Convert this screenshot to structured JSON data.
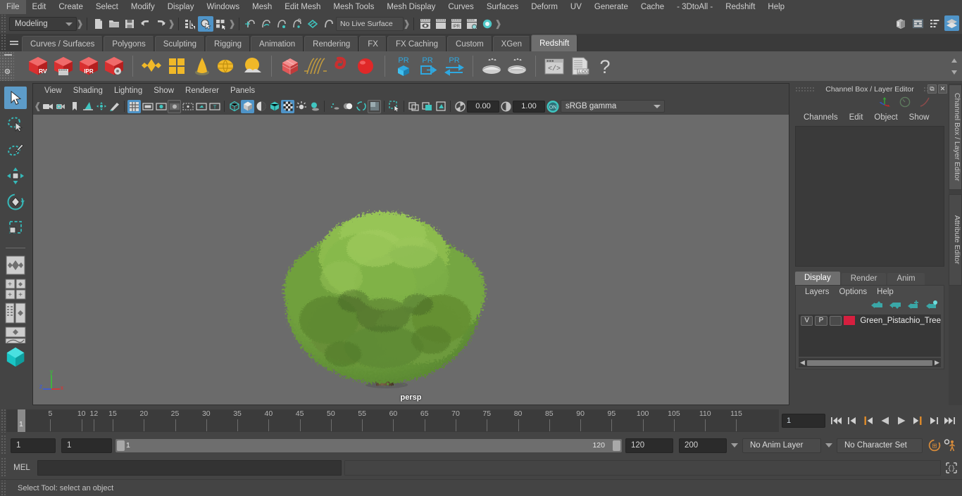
{
  "menubar": {
    "items": [
      "File",
      "Edit",
      "Create",
      "Select",
      "Modify",
      "Display",
      "Windows",
      "Mesh",
      "Edit Mesh",
      "Mesh Tools",
      "Mesh Display",
      "Curves",
      "Surfaces",
      "Deform",
      "UV",
      "Generate",
      "Cache",
      "- 3DtoAll -",
      "Redshift",
      "Help"
    ]
  },
  "statusline": {
    "mode": "Modeling",
    "live_surface": "No Live Surface",
    "icons": [
      "new-scene-icon",
      "open-scene-icon",
      "save-scene-icon",
      "undo-icon",
      "redo-icon",
      "select-by-hierarchy-icon",
      "select-by-object-icon",
      "select-by-component-icon",
      "snap-to-grid-icon",
      "snap-to-curve-icon",
      "snap-to-point-icon",
      "snap-to-projected-center-icon",
      "snap-to-view-plane-icon",
      "make-live-icon",
      "render-view-icon",
      "render-sequence-icon",
      "ipr-render-icon",
      "render-settings-icon",
      "render-globals-icon",
      "light-toggle-icon"
    ],
    "right_icons": [
      "show-hide-modeling-toolkit-icon",
      "show-hide-attribute-editor-icon",
      "show-hide-tool-settings-icon",
      "show-hide-channel-box-icon"
    ]
  },
  "shelf": {
    "tabs": [
      "Curves / Surfaces",
      "Polygons",
      "Sculpting",
      "Rigging",
      "Animation",
      "Rendering",
      "FX",
      "FX Caching",
      "Custom",
      "XGen",
      "Redshift"
    ],
    "selected_tab": "Redshift",
    "icons": [
      {
        "name": "redshift-render-view-icon",
        "label": "RV"
      },
      {
        "name": "redshift-render-sequence-icon",
        "label": ""
      },
      {
        "name": "redshift-ipr-icon",
        "label": "IPR"
      },
      {
        "name": "redshift-render-settings-icon",
        "label": ""
      },
      {
        "name": "redshift-material-icon",
        "label": ""
      },
      {
        "name": "redshift-material-blender-icon",
        "label": ""
      },
      {
        "name": "redshift-light-cone-icon",
        "label": ""
      },
      {
        "name": "redshift-dome-light-icon",
        "label": ""
      },
      {
        "name": "redshift-environment-icon",
        "label": ""
      },
      {
        "name": "redshift-proxy-cube-icon",
        "label": ""
      },
      {
        "name": "redshift-hair-icon",
        "label": ""
      },
      {
        "name": "redshift-volume-icon",
        "label": ""
      },
      {
        "name": "redshift-sphere-icon",
        "label": ""
      },
      {
        "name": "redshift-pr-cube-icon",
        "label": "PR"
      },
      {
        "name": "redshift-pr-export-icon",
        "label": "PR"
      },
      {
        "name": "redshift-pr-swap-icon",
        "label": "PR"
      },
      {
        "name": "redshift-bake-icon",
        "label": ""
      },
      {
        "name": "redshift-bake-all-icon",
        "label": ""
      },
      {
        "name": "redshift-script-editor-icon",
        "label": ""
      },
      {
        "name": "redshift-log-icon",
        "label": ".LOG"
      },
      {
        "name": "redshift-help-icon",
        "label": "?"
      }
    ]
  },
  "toolbox": {
    "tools": [
      "select-tool",
      "lasso-select-tool",
      "paint-select-tool",
      "move-tool",
      "rotate-tool",
      "scale-tool"
    ],
    "selected_tool": "select-tool",
    "layouts": [
      "single-perspective-layout",
      "four-view-layout",
      "outliner-persp-layout",
      "persp-graph-layout",
      "hypershade-layout"
    ]
  },
  "viewport": {
    "menus": [
      "View",
      "Shading",
      "Lighting",
      "Show",
      "Renderer",
      "Panels"
    ],
    "camera_label": "persp",
    "exposure": "0.00",
    "gamma_value": "1.00",
    "color_management": "sRGB gamma",
    "color_management_toggle": "ON",
    "background_color": "#6b6b6b",
    "toolbar_icons": [
      "select-camera-icon",
      "camera-attributes-icon",
      "bookmark-icon",
      "image-plane-icon",
      "two-d-pan-zoom-icon",
      "grease-pencil-icon",
      "grid-toggle-icon",
      "film-gate-icon",
      "resolution-gate-icon",
      "gate-mask-icon",
      "film-origin-icon",
      "safe-action-icon",
      "title-safe-icon",
      "wireframe-icon",
      "smooth-shade-all-icon",
      "shaded-flat-icon",
      "wireframe-on-shaded-icon",
      "texture-toggle-icon",
      "use-default-lighting-icon",
      "shadows-icon",
      "ambient-occlusion-icon",
      "motion-blur-icon",
      "multisample-icon",
      "depth-of-field-icon",
      "isolate-select-icon",
      "xray-icon",
      "xray-joints-icon",
      "xray-active-components-icon",
      "exposure-icon",
      "gamma-icon"
    ]
  },
  "channelbox": {
    "title": "Channel Box / Layer Editor",
    "menus": [
      "Channels",
      "Edit",
      "Object",
      "Show"
    ],
    "icons": [
      "transform-axis-icon",
      "speedometer-icon",
      "curve-icon"
    ],
    "window_buttons": [
      "restore-icon",
      "close-icon"
    ]
  },
  "layereditor": {
    "tabs": [
      "Display",
      "Render",
      "Anim"
    ],
    "selected_tab": "Display",
    "menus": [
      "Layers",
      "Options",
      "Help"
    ],
    "buttons": [
      "move-layer-up-icon",
      "move-layer-down-icon",
      "create-new-layer-icon",
      "create-layer-from-selected-icon"
    ],
    "layers": [
      {
        "visibility": "V",
        "playback": "P",
        "shading": "",
        "color": "#d61f3f",
        "name": "Green_Pistachio_Tree"
      }
    ]
  },
  "vertical_tabs": [
    "Channel Box / Layer Editor",
    "Attribute Editor"
  ],
  "timeline": {
    "ticks": [
      5,
      10,
      15,
      20,
      25,
      30,
      35,
      40,
      45,
      50,
      55,
      60,
      65,
      70,
      75,
      80,
      85,
      90,
      95,
      100,
      105,
      110,
      115,
      "12"
    ],
    "current_frame": "1",
    "frame_field": "1",
    "playback_buttons": [
      "go-to-start-icon",
      "step-back-keyframe-icon",
      "step-back-frame-icon",
      "play-backwards-icon",
      "play-forwards-icon",
      "step-forward-frame-icon",
      "step-forward-keyframe-icon",
      "go-to-end-icon"
    ]
  },
  "rangeslider": {
    "anim_start": "1",
    "range_start": "1",
    "bar_start_label": "1",
    "bar_end_label": "120",
    "range_end": "120",
    "anim_end": "200",
    "anim_layer": "No Anim Layer",
    "character_set": "No Character Set",
    "right_icons": [
      "auto-key-icon",
      "animation-preferences-icon"
    ]
  },
  "commandline": {
    "language_label": "MEL",
    "input_value": "",
    "output_value": "",
    "icon": "script-editor-icon"
  },
  "helpline": {
    "text": "Select Tool: select an object"
  }
}
